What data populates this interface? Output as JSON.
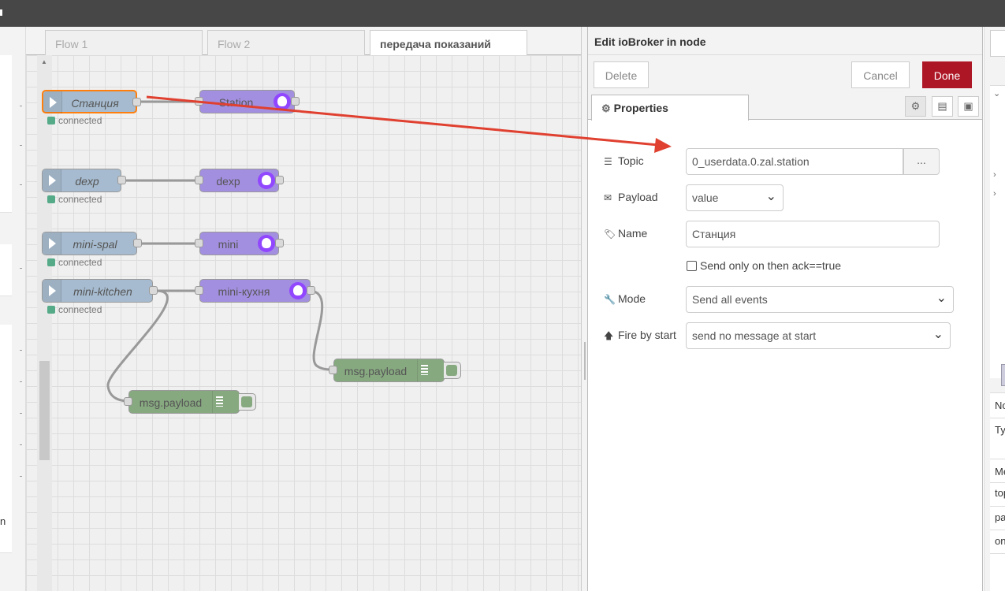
{
  "tabs": [
    {
      "label": "Flow 1",
      "active": false
    },
    {
      "label": "Flow 2",
      "active": false
    },
    {
      "label": "передача показаний",
      "active": true
    }
  ],
  "palette": {
    "visible_letter": "n"
  },
  "flow": {
    "inputs": [
      {
        "label": "Станция",
        "status": "connected",
        "selected": true
      },
      {
        "label": "dexp",
        "status": "connected"
      },
      {
        "label": "mini-spal",
        "status": "connected"
      },
      {
        "label": "mini-kitchen",
        "status": "connected"
      }
    ],
    "outputs": [
      {
        "label": "Station"
      },
      {
        "label": "dexp"
      },
      {
        "label": "mini"
      },
      {
        "label": "mini-кухня"
      }
    ],
    "debug_nodes": [
      {
        "label": "msg.payload"
      },
      {
        "label": "msg.payload"
      }
    ]
  },
  "editor": {
    "title": "Edit ioBroker in node",
    "delete_label": "Delete",
    "cancel_label": "Cancel",
    "done_label": "Done",
    "tab_label": "Properties",
    "topic_label": "Topic",
    "topic_value": "0_userdata.0.zal.station",
    "topic_browse": "...",
    "payload_label": "Payload",
    "payload_value": "value",
    "name_label": "Name",
    "name_value": "Станция",
    "ack_label": "Send only on then ack==true",
    "mode_label": "Mode",
    "mode_value": "Send all events",
    "fire_label": "Fire by start",
    "fire_value": "send no message at start"
  },
  "sidebar": {
    "props": [
      "No",
      "Ty",
      "Me",
      "top",
      "pa",
      "on"
    ]
  },
  "colors": {
    "done_button": "#ad1625",
    "annotation_arrow": "#e04030",
    "input_node": "#a6bbcf",
    "output_node": "#a38fe0",
    "debug_node": "#87a980"
  }
}
